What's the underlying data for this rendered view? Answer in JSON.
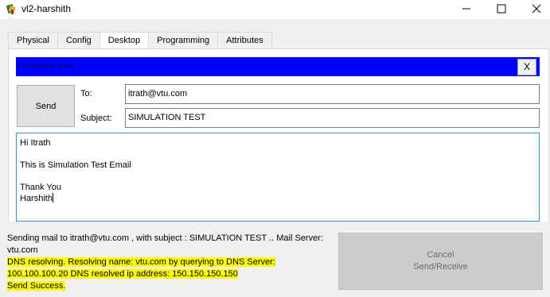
{
  "window": {
    "title": "vl2-harshith",
    "controls": {
      "minimize": "minimize-icon",
      "maximize": "maximize-icon",
      "close": "close-icon"
    }
  },
  "tabs": [
    {
      "label": "Physical",
      "active": false
    },
    {
      "label": "Config",
      "active": false
    },
    {
      "label": "Desktop",
      "active": true
    },
    {
      "label": "Programming",
      "active": false
    },
    {
      "label": "Attributes",
      "active": false
    }
  ],
  "compose": {
    "title": "Compose Mail",
    "close_label": "X",
    "send_label": "Send",
    "to_label": "To:",
    "to_value": "itrath@vtu.com",
    "subject_label": "Subject:",
    "subject_value": "SIMULATION TEST",
    "body_lines": [
      "Hi Itrath",
      "",
      "This is Simulation Test Email",
      "",
      "Thank You",
      "Harshith"
    ]
  },
  "status": {
    "line1": "Sending mail to itrath@vtu.com , with subject : SIMULATION TEST ..   Mail Server:",
    "line2": "vtu.com",
    "line3": "DNS resolving. Resolving name: vtu.com by querying to DNS Server:",
    "line4": "100.100.100.20  DNS resolved ip address: 150.150.150.150",
    "line5": "Send Success."
  },
  "send_receive": {
    "cancel": "Cancel",
    "label": "Send/Receive"
  },
  "colors": {
    "compose_header": "#0000ff",
    "highlight": "#ffff00",
    "active_tab_underline": "#1f5c99"
  }
}
